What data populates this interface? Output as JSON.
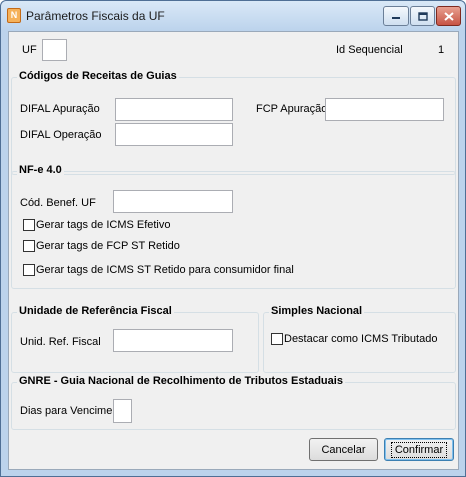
{
  "window": {
    "title": "Parâmetros Fiscais da UF",
    "app_icon_glyph": "N",
    "accent_color": "#bcd3ec"
  },
  "top": {
    "uf_label": "UF",
    "uf_value": "",
    "id_sequencial_label": "Id Sequencial",
    "id_sequencial_value": "1"
  },
  "codigos": {
    "title": "Códigos de Receitas de Guias",
    "difal_apuracao_label": "DIFAL Apuração",
    "difal_apuracao_value": "",
    "difal_operacao_label": "DIFAL Operação",
    "difal_operacao_value": "",
    "fcp_apuracao_label": "FCP Apuração",
    "fcp_apuracao_value": ""
  },
  "nfe": {
    "title": "NF-e 4.0",
    "cod_benef_label": "Cód. Benef. UF",
    "cod_benef_value": "",
    "check_icms_efetivo": "Gerar tags de ICMS Efetivo",
    "check_fcp_st_retido": "Gerar tags de FCP ST Retido",
    "check_icms_st_retido": "Gerar tags de ICMS ST Retido para consumidor final"
  },
  "ufr": {
    "title": "Unidade de Referência Fiscal",
    "unid_label": "Unid. Ref. Fiscal",
    "unid_value": ""
  },
  "simples": {
    "title": "Simples Nacional",
    "check_destacar": "Destacar como ICMS Tributado"
  },
  "gnre": {
    "title": "GNRE - Guia Nacional de Recolhimento de Tributos Estaduais",
    "dias_label": "Dias para Vencimento",
    "dias_value": ""
  },
  "buttons": {
    "cancel": "Cancelar",
    "confirm": "Confirmar"
  }
}
